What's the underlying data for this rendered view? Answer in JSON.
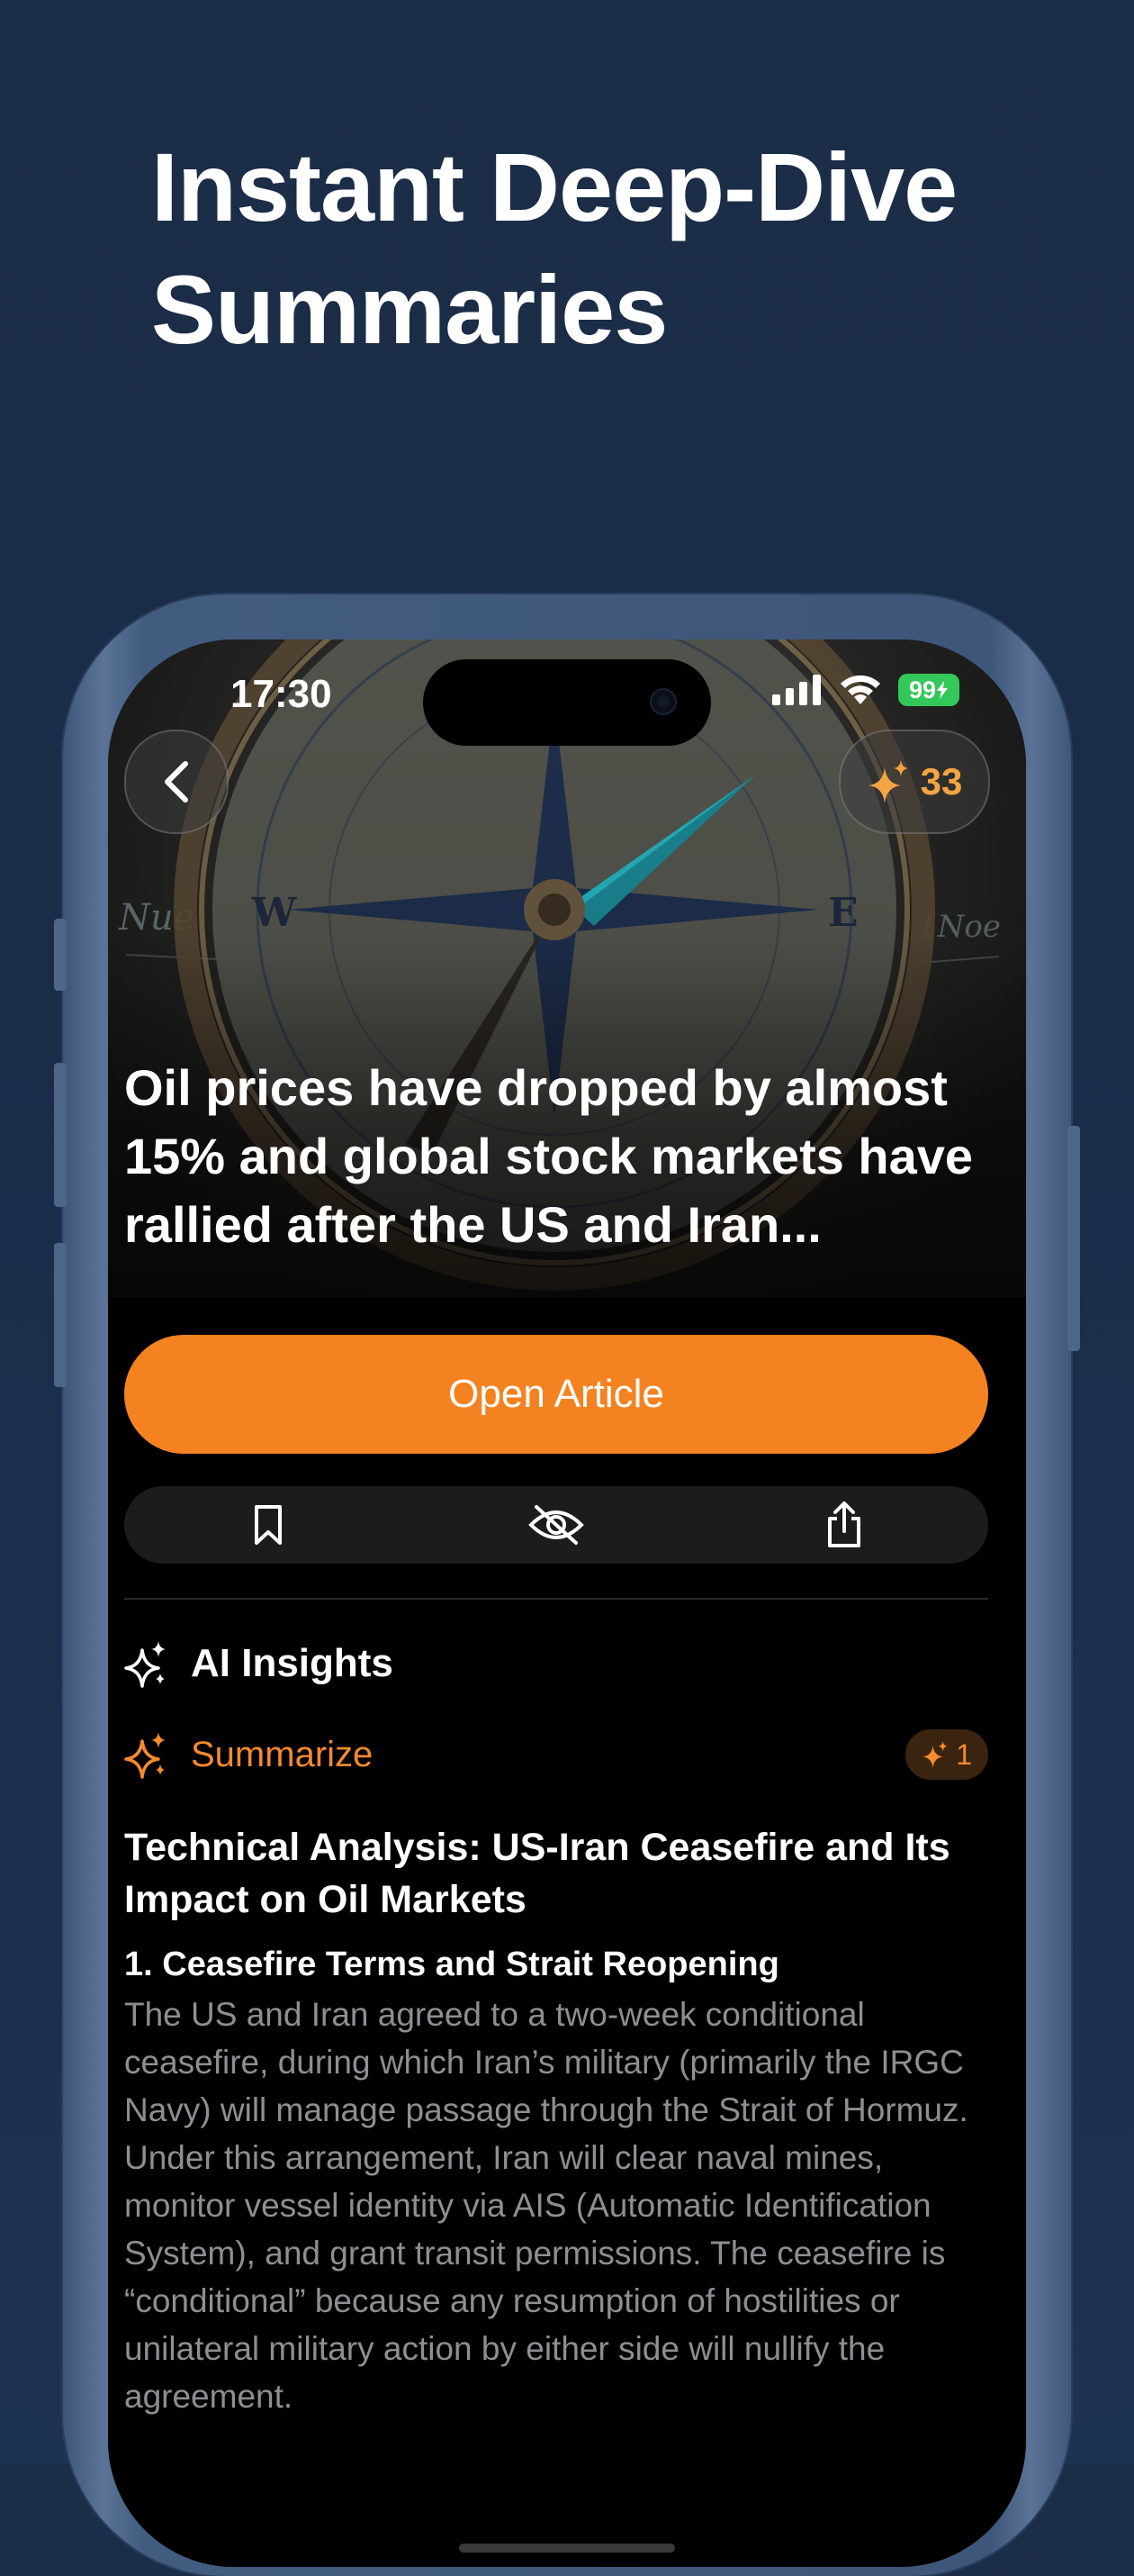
{
  "headline": "Instant Deep-Dive Summaries",
  "status_bar": {
    "time": "17:30",
    "battery": "99"
  },
  "article": {
    "credits": "33",
    "title": "Oil prices have dropped by almost 15% and global stock markets have rallied after the US and Iran...",
    "open_label": "Open Article"
  },
  "actions": {
    "bookmark_icon": "bookmark-icon",
    "hide_icon": "eye-slash-icon",
    "share_icon": "share-icon"
  },
  "insights": {
    "label": "AI Insights",
    "summarize_label": "Summarize",
    "cost": "1"
  },
  "summary": {
    "title": "Technical Analysis: US-Iran Ceasefire and Its Impact on Oil Markets",
    "section_heading": "1. Ceasefire Terms and Strait Reopening",
    "section_body": "The US and Iran agreed to a two-week conditional ceasefire, during which Iran’s military (primarily the IRGC Navy) will manage passage through the Strait of Hormuz. Under this arrangement, Iran will clear naval mines, monitor vessel identity via AIS (Automatic Identification System), and grant transit permissions. The ceasefire is “conditional” because any resumption of hostilities or unilateral military action by either side will nullify the agreement."
  },
  "colors": {
    "accent": "#f58220",
    "background": "#1c2d47",
    "body_text": "#8e8e93"
  }
}
